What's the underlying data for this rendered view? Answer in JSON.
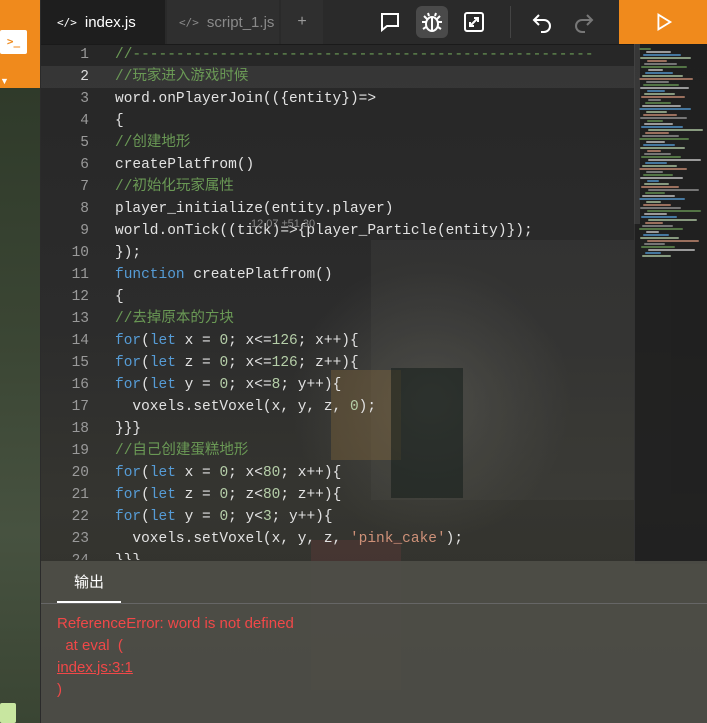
{
  "tabs": [
    {
      "label": "index.js",
      "active": true
    },
    {
      "label": "script_1.js",
      "active": false
    }
  ],
  "tab_add_label": "+",
  "toolbar": {
    "icons": [
      "comment-icon",
      "bug-icon",
      "expand-icon",
      "undo-icon",
      "redo-icon",
      "play-icon"
    ]
  },
  "colors": {
    "accent": "#f08a1c",
    "error": "#f04848",
    "comment": "#6a9955",
    "keyword": "#569cd6"
  },
  "left_strip": {
    "terminal_glyph": ">_",
    "caret": "▼"
  },
  "editor": {
    "active_line": 2,
    "inline_hint": "12.07 ±51.30",
    "lines": [
      {
        "n": "1",
        "t": "//-----------------------------------------------------"
      },
      {
        "n": "2",
        "t": "//玩家进入游戏时候"
      },
      {
        "n": "3",
        "t": "word.onPlayerJoin(({entity})=>"
      },
      {
        "n": "4",
        "t": "{"
      },
      {
        "n": "5",
        "t": "//创建地形"
      },
      {
        "n": "6",
        "t": "createPlatfrom()"
      },
      {
        "n": "7",
        "t": "//初始化玩家属性"
      },
      {
        "n": "8",
        "t": "player_initialize(entity.player)"
      },
      {
        "n": "9",
        "t": "world.onTick((tick)=>{player_Particle(entity)});"
      },
      {
        "n": "10",
        "t": "});"
      },
      {
        "n": "11",
        "t": "function createPlatfrom()"
      },
      {
        "n": "12",
        "t": "{"
      },
      {
        "n": "13",
        "t": "//去掉原本的方块"
      },
      {
        "n": "14",
        "t": "for(let x = 0; x<=126; x++){"
      },
      {
        "n": "15",
        "t": "for(let z = 0; x<=126; z++){"
      },
      {
        "n": "16",
        "t": "for(let y = 0; x<=8; y++){"
      },
      {
        "n": "17",
        "t": "  voxels.setVoxel(x, y, z, 0);"
      },
      {
        "n": "18",
        "t": "}}}"
      },
      {
        "n": "19",
        "t": "//自己创建蛋糕地形"
      },
      {
        "n": "20",
        "t": "for(let x = 0; x<80; x++){"
      },
      {
        "n": "21",
        "t": "for(let z = 0; z<80; z++){"
      },
      {
        "n": "22",
        "t": "for(let y = 0; y<3; y++){"
      },
      {
        "n": "23",
        "t": "  voxels.setVoxel(x, y, z, 'pink_cake');"
      },
      {
        "n": "24",
        "t": "}}}"
      }
    ]
  },
  "output": {
    "tab_label": "输出",
    "error_line1": "ReferenceError: word is not defined",
    "error_line2": "  at eval  (",
    "error_link": "index.js:3:1",
    "error_line4": ")"
  }
}
